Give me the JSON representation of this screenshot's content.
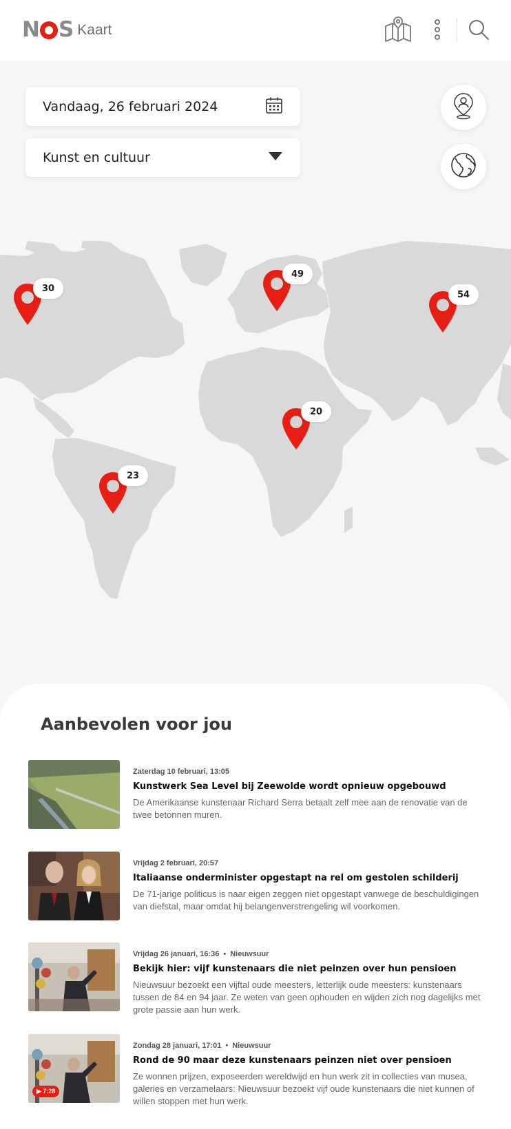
{
  "brand": {
    "logo_n": "N",
    "logo_s": "S",
    "logo_subtitle": "Kaart",
    "accent": "#e61e14"
  },
  "header": {
    "icons": [
      "map-icon",
      "more-vertical-icon",
      "search-icon"
    ]
  },
  "filters": {
    "date_label": "Vandaag, 26 februari 2024",
    "category_label": "Kunst en cultuur",
    "date_icon": "calendar-icon",
    "category_icon": "chevron-down-icon"
  },
  "map_buttons": {
    "locate_icon": "location-person-icon",
    "globe_icon": "globe-icon"
  },
  "map_pins": [
    {
      "region": "north-america",
      "count": "30"
    },
    {
      "region": "europe",
      "count": "49"
    },
    {
      "region": "asia",
      "count": "54"
    },
    {
      "region": "africa",
      "count": "20"
    },
    {
      "region": "south-america",
      "count": "23"
    }
  ],
  "recommended": {
    "title": "Aanbevolen voor jou",
    "articles": [
      {
        "meta": "Zaterdag 10 februari, 13:05",
        "source": "",
        "title": "Kunstwerk Sea Level bij Zeewolde wordt opnieuw opgebouwd",
        "description": "De Amerikaanse kunstenaar Richard Serra betaalt zelf mee aan de renovatie van de twee betonnen muren."
      },
      {
        "meta": "Vrijdag 2 februari, 20:57",
        "source": "",
        "title": "Italiaanse onderminister opgestapt na rel om gestolen schilderij",
        "description": "De 71-jarige politicus is naar eigen zeggen niet opgestapt vanwege de beschuldigingen van diefstal, maar omdat hij belangenverstrengeling wil voorkomen."
      },
      {
        "meta": "Vrijdag 26 januari, 16:36",
        "source": "Nieuwsuur",
        "title": "Bekijk hier: vijf kunstenaars die niet peinzen over hun pensioen",
        "description": "Nieuwsuur bezoekt een vijftal oude meesters, letterlijk oude meesters: kunstenaars tussen de 84 en 94 jaar. Ze weten van geen ophouden en wijden zich nog dagelijks met grote passie aan hun werk."
      },
      {
        "meta": "Zondag 28 januari, 17:01",
        "source": "Nieuwsuur",
        "title": "Rond de 90 maar deze kunstenaars peinzen niet over pensioen",
        "description": "Ze wonnen prijzen, exposeerden wereldwijd en hun werk zit in collecties van musea, galeries en verzamelaars: Nieuwsuur bezoekt vijf oude kunstenaars die niet kunnen of willen stoppen met hun werk.",
        "duration": "7:28"
      }
    ]
  }
}
